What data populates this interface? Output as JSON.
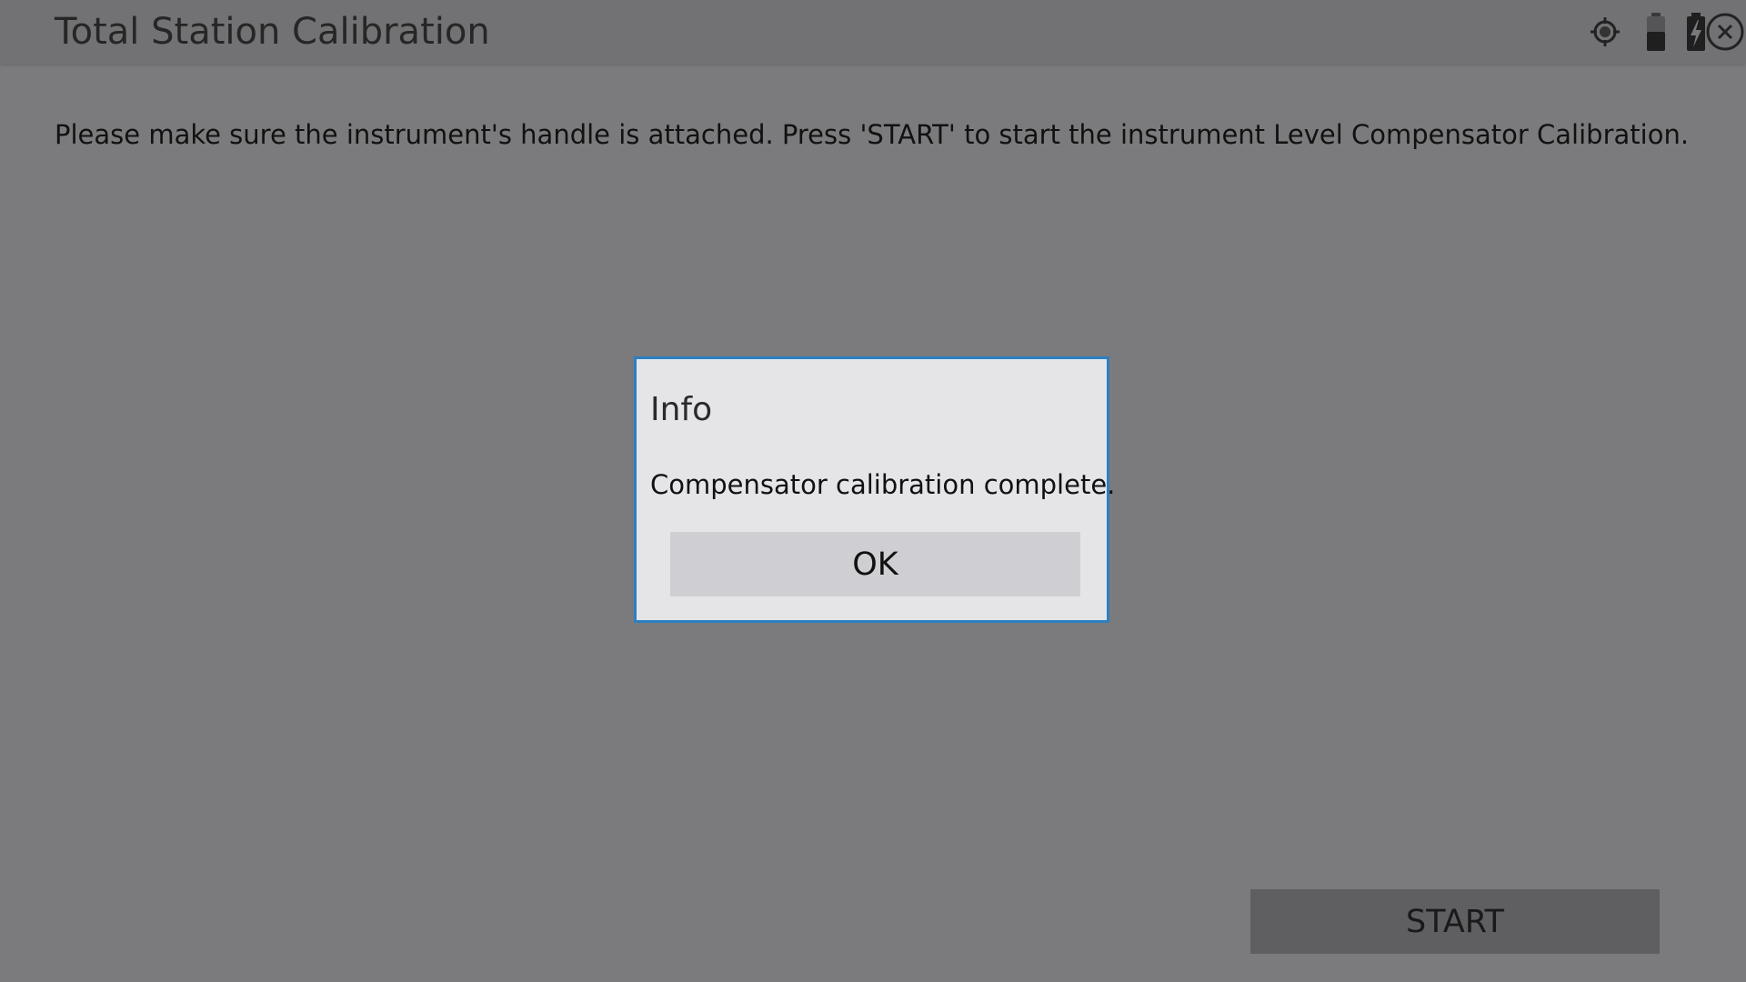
{
  "window": {
    "title": "Total Station Calibration"
  },
  "status_icons": [
    {
      "name": "target-icon"
    },
    {
      "name": "battery-icon"
    },
    {
      "name": "battery-charging-icon"
    },
    {
      "name": "close-icon"
    }
  ],
  "main": {
    "instruction": "Please make sure the instrument's handle is attached. Press 'START' to start the instrument Level Compensator Calibration.",
    "start_label": "START"
  },
  "dialog": {
    "title": "Info",
    "message": "Compensator calibration complete.",
    "ok_label": "OK"
  },
  "colors": {
    "background": "#7b7b7d",
    "titlebar": "#727274",
    "dialog_border": "#2b80c4",
    "dialog_background": "#e5e5e8"
  }
}
